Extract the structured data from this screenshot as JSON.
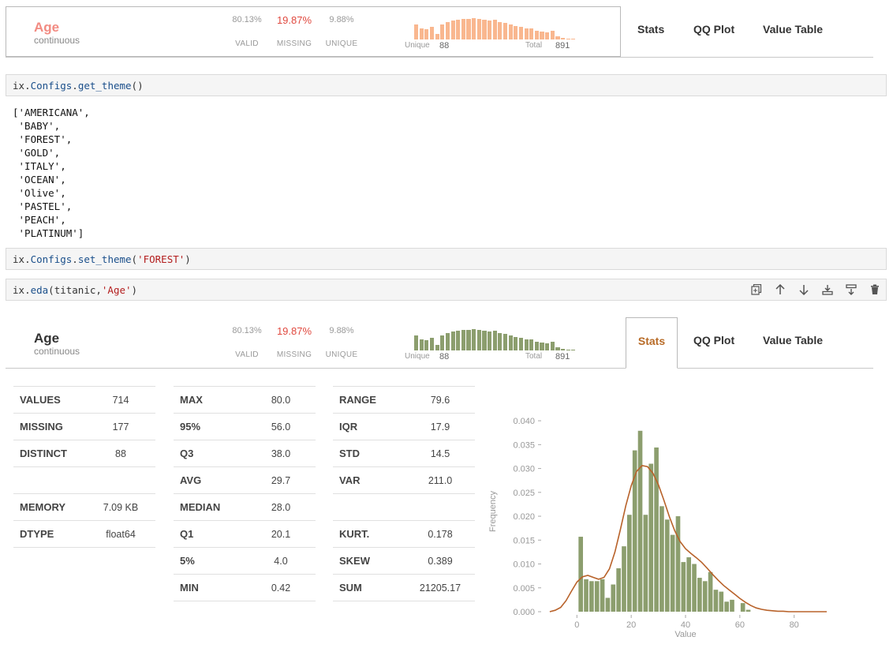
{
  "top_summary": {
    "name": "Age",
    "type": "continuous",
    "valid_pct": "80.13%",
    "missing_pct": "19.87%",
    "unique_pct": "9.88%",
    "valid_label": "VALID",
    "missing_label": "MISSING",
    "unique_label": "UNIQUE",
    "unique_text": "Unique",
    "unique_value": "88",
    "total_text": "Total",
    "total_value": "891",
    "tabs": [
      "Stats",
      "QQ Plot",
      "Value Table"
    ],
    "accent": "#f9b78f",
    "name_color": "#f28b82"
  },
  "cells": {
    "get_theme": {
      "obj": "ix",
      "dot1": ".",
      "attr": "Configs",
      "dot2": ".",
      "fn": "get_theme",
      "args": "()"
    },
    "output": "['AMERICANA',\n 'BABY',\n 'FOREST',\n 'GOLD',\n 'ITALY',\n 'OCEAN',\n 'Olive',\n 'PASTEL',\n 'PEACH',\n 'PLATINUM']",
    "set_theme": {
      "obj": "ix",
      "dot1": ".",
      "attr": "Configs",
      "dot2": ".",
      "fn": "set_theme",
      "open": "(",
      "arg": "'FOREST'",
      "close": ")"
    },
    "eda": {
      "obj": "ix",
      "dot1": ".",
      "fn": "eda",
      "open": "(titanic,",
      "arg": "'Age'",
      "close": ")"
    },
    "toolbar_icons": [
      "copy-icon",
      "move-up-icon",
      "move-down-icon",
      "insert-below-icon",
      "merge-icon",
      "delete-icon"
    ]
  },
  "summary": {
    "name": "Age",
    "type": "continuous",
    "valid_pct": "80.13%",
    "missing_pct": "19.87%",
    "unique_pct": "9.88%",
    "valid_label": "VALID",
    "missing_label": "MISSING",
    "unique_label": "UNIQUE",
    "unique_text": "Unique",
    "unique_value": "88",
    "total_text": "Total",
    "total_value": "891",
    "tabs": [
      "Stats",
      "QQ Plot",
      "Value Table"
    ],
    "active_tab": "Stats",
    "accent": "#8c9e6e",
    "tab_accent": "#b86b27"
  },
  "mini_hist_heights": [
    0.62,
    0.48,
    0.45,
    0.52,
    0.25,
    0.62,
    0.72,
    0.8,
    0.82,
    0.88,
    0.86,
    0.9,
    0.86,
    0.84,
    0.8,
    0.82,
    0.72,
    0.7,
    0.62,
    0.58,
    0.52,
    0.46,
    0.48,
    0.36,
    0.34,
    0.3,
    0.38,
    0.12,
    0.08,
    0.05,
    0.05
  ],
  "stats": {
    "col1": [
      {
        "label": "VALUES",
        "value": "714"
      },
      {
        "label": "MISSING",
        "value": "177"
      },
      {
        "label": "DISTINCT",
        "value": "88"
      },
      {
        "label": "",
        "value": ""
      },
      {
        "label": "MEMORY",
        "value": "7.09 KB"
      },
      {
        "label": "DTYPE",
        "value": "float64"
      }
    ],
    "col2": [
      {
        "label": "MAX",
        "value": "80.0"
      },
      {
        "label": "95%",
        "value": "56.0"
      },
      {
        "label": "Q3",
        "value": "38.0"
      },
      {
        "label": "AVG",
        "value": "29.7"
      },
      {
        "label": "MEDIAN",
        "value": "28.0"
      },
      {
        "label": "Q1",
        "value": "20.1"
      },
      {
        "label": "5%",
        "value": "4.0"
      },
      {
        "label": "MIN",
        "value": "0.42"
      }
    ],
    "col3": [
      {
        "label": "RANGE",
        "value": "79.6"
      },
      {
        "label": "IQR",
        "value": "17.9"
      },
      {
        "label": "STD",
        "value": "14.5"
      },
      {
        "label": "VAR",
        "value": "211.0"
      },
      {
        "label": "",
        "value": ""
      },
      {
        "label": "KURT.",
        "value": "0.178"
      },
      {
        "label": "SKEW",
        "value": "0.389"
      },
      {
        "label": "SUM",
        "value": "21205.17"
      }
    ]
  },
  "chart_data": {
    "type": "bar",
    "xlabel": "Value",
    "ylabel": "Frequency",
    "xlim": [
      -12,
      92
    ],
    "ylim": [
      0,
      0.042
    ],
    "xticks": [
      0,
      20,
      40,
      60,
      80
    ],
    "yticks": [
      0.0,
      0.005,
      0.01,
      0.015,
      0.02,
      0.025,
      0.03,
      0.035,
      0.04
    ],
    "bin_start": 0.42,
    "bin_width": 1.99,
    "values": [
      0.0157,
      0.0068,
      0.0064,
      0.0064,
      0.0068,
      0.0029,
      0.0057,
      0.0091,
      0.0137,
      0.0203,
      0.0338,
      0.0379,
      0.0203,
      0.031,
      0.0344,
      0.0221,
      0.0193,
      0.0161,
      0.02,
      0.0104,
      0.0114,
      0.01,
      0.0071,
      0.0064,
      0.0083,
      0.0046,
      0.0042,
      0.0021,
      0.0025,
      0.0,
      0.0018,
      0.0004
    ],
    "kde_x": [
      -10,
      -8,
      -6,
      -4,
      -2,
      0,
      2,
      4,
      6,
      8,
      10,
      12,
      14,
      16,
      18,
      20,
      22,
      24,
      26,
      28,
      30,
      32,
      34,
      36,
      38,
      40,
      42,
      44,
      46,
      48,
      50,
      52,
      54,
      56,
      58,
      60,
      62,
      64,
      66,
      68,
      70,
      72,
      74,
      76,
      78,
      80,
      84,
      88,
      92
    ],
    "kde_y": [
      0.0,
      0.0003,
      0.0009,
      0.0023,
      0.0043,
      0.0062,
      0.0073,
      0.0076,
      0.0072,
      0.0068,
      0.0072,
      0.009,
      0.0125,
      0.0172,
      0.0222,
      0.0264,
      0.0294,
      0.0306,
      0.0304,
      0.029,
      0.0266,
      0.0234,
      0.02,
      0.017,
      0.0147,
      0.0132,
      0.0122,
      0.0113,
      0.0103,
      0.0091,
      0.0078,
      0.0066,
      0.0055,
      0.0046,
      0.0037,
      0.0028,
      0.002,
      0.0013,
      0.0008,
      0.0005,
      0.0003,
      0.0002,
      0.0001,
      0.0001,
      0.0,
      0.0,
      0.0,
      0.0,
      0.0
    ],
    "bar_color": "#8c9e6e",
    "kde_color": "#b8622a"
  }
}
